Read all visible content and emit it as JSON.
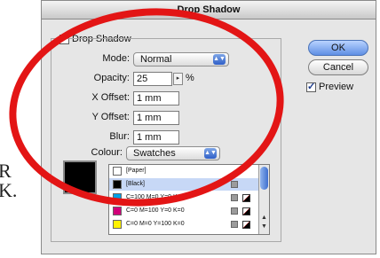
{
  "background_text": {
    "line1": "R",
    "line2": "K."
  },
  "window": {
    "title": "Drop Shadow"
  },
  "drop_shadow": {
    "label": "Drop Shadow",
    "checked": true
  },
  "mode": {
    "label": "Mode:",
    "value": "Normal"
  },
  "opacity": {
    "label": "Opacity:",
    "value": "25",
    "unit": "%"
  },
  "x_offset": {
    "label": "X Offset:",
    "value": "1 mm"
  },
  "y_offset": {
    "label": "Y Offset:",
    "value": "1 mm"
  },
  "blur": {
    "label": "Blur:",
    "value": "1 mm"
  },
  "colour": {
    "label": "Colour:",
    "value": "Swatches"
  },
  "buttons": {
    "ok": "OK",
    "cancel": "Cancel"
  },
  "preview": {
    "label": "Preview",
    "checked": true
  },
  "swatches": [
    {
      "name": "[Paper]",
      "color": "#ffffff"
    },
    {
      "name": "[Black]",
      "color": "#000000",
      "selected": true
    },
    {
      "name": "C=100 M=0 Y=0 K=0",
      "color": "#00a0e6"
    },
    {
      "name": "C=0 M=100 Y=0 K=0",
      "color": "#d1007a"
    },
    {
      "name": "C=0 M=0 Y=100 K=0",
      "color": "#fff200"
    }
  ],
  "annotation_color": "#e31515"
}
